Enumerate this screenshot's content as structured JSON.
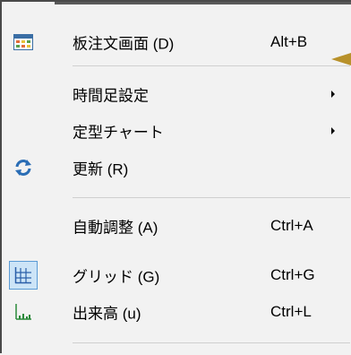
{
  "menu": {
    "items": [
      {
        "label": "板注文画面 (D)",
        "shortcut": "Alt+B",
        "icon": "order-board-icon"
      },
      {
        "label": "時間足設定",
        "submenu": true
      },
      {
        "label": "定型チャート",
        "submenu": true
      },
      {
        "label": "更新 (R)",
        "icon": "refresh-icon"
      },
      {
        "label": "自動調整 (A)",
        "shortcut": "Ctrl+A"
      },
      {
        "label": "グリッド (G)",
        "shortcut": "Ctrl+G",
        "icon": "grid-icon",
        "checked": true
      },
      {
        "label": "出来高 (u)",
        "shortcut": "Ctrl+L",
        "icon": "volume-icon"
      }
    ]
  },
  "colors": {
    "background": "#f2f2f2",
    "separator": "#cfcfcf",
    "checked_bg": "#cce4f7",
    "checked_border": "#5a9bd5",
    "pointer": "#b8912a"
  }
}
